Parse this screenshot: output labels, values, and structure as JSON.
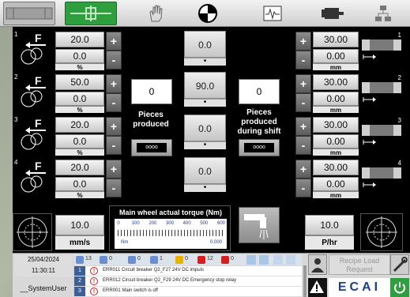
{
  "toolbar": {
    "icons": [
      "grey-panel-icon",
      "production-icon",
      "hand-icon",
      "quadrant-icon",
      "oscillogram-icon",
      "motor-icon",
      "network-icon"
    ]
  },
  "stations": [
    {
      "num": "1",
      "label": "F",
      "upper": "20.0",
      "lower": "0.0",
      "unit": "%"
    },
    {
      "num": "2",
      "label": "F",
      "upper": "50.0",
      "lower": "0.0",
      "unit": "%"
    },
    {
      "num": "3",
      "label": "F",
      "upper": "20.0",
      "lower": "0.0",
      "unit": "%"
    },
    {
      "num": "4",
      "label": "F",
      "upper": "20.0",
      "lower": "0.0",
      "unit": "%"
    }
  ],
  "right_stations": [
    {
      "num": "1",
      "upper": "30.00",
      "lower": "0.00",
      "unit": "mm"
    },
    {
      "num": "2",
      "upper": "30.00",
      "lower": "0.00",
      "unit": "mm"
    },
    {
      "num": "3",
      "upper": "30.00",
      "lower": "0.00",
      "unit": "mm"
    },
    {
      "num": "4",
      "upper": "30.00",
      "lower": "0.00",
      "unit": "mm"
    }
  ],
  "plus": "+",
  "minus": "-",
  "center": {
    "v1": "0.0",
    "v2": "90.0",
    "v3": "0.0",
    "v4": "0.0",
    "dot": "•"
  },
  "pieces": {
    "value": "0",
    "label": "Pieces produced",
    "btn": "oooo"
  },
  "pieces_shift": {
    "value": "0",
    "label": "Pieces produced during shift",
    "btn": "oooo"
  },
  "speed": {
    "value": "10.0",
    "unit": "mm/s"
  },
  "rate": {
    "value": "10.0",
    "unit": "P/hr"
  },
  "torque": {
    "title": "Main wheel actual torque (Nm)",
    "ticks": [
      "0",
      "100",
      "200",
      "300",
      "400",
      "500",
      "600"
    ],
    "unit": "Nm",
    "value": "0.000",
    "level": 0
  },
  "status": {
    "date": "25/04/2024",
    "time": "11:30:11",
    "user": "__SystemUser"
  },
  "alarm_counts": {
    "c1": "13",
    "c2": "0",
    "c3": "0",
    "c4": "1",
    "c5": "0",
    "c6": "12",
    "c7": "0"
  },
  "alarms": [
    {
      "num": "1",
      "text": "ERR011 Circuit breaker Q2_F27 24V DC impuls"
    },
    {
      "num": "2",
      "text": "ERR012 Circuit breaker Q2_F29 24V DC Emergency stop relay"
    },
    {
      "num": "3",
      "text": "ERR001 Main switch is off"
    }
  ],
  "recipe": {
    "line1": "Recipe Load",
    "line2": "Request"
  },
  "brand": "ECAI",
  "colors": {
    "accent": "#2e9e3e",
    "alarm": "#d62020"
  }
}
